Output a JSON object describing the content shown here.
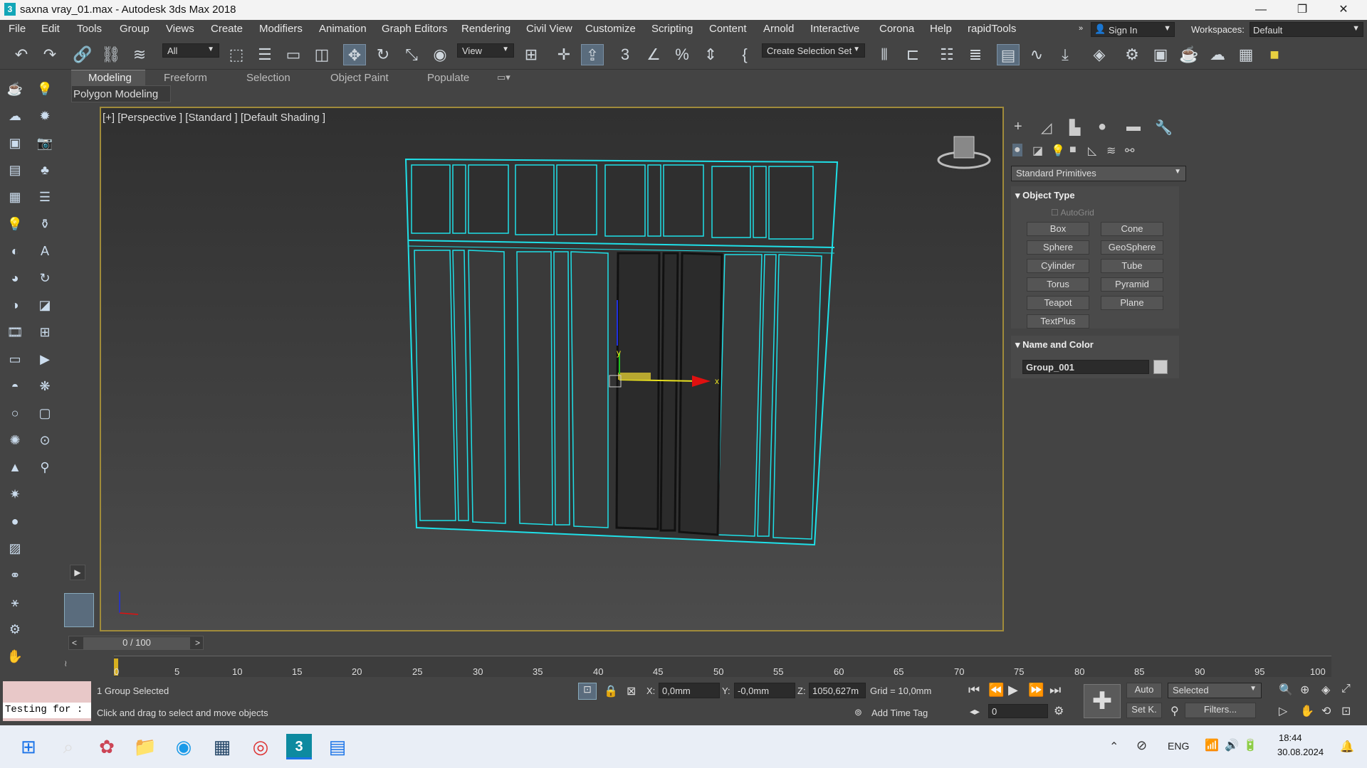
{
  "window": {
    "title": "saxna vray_01.max - Autodesk 3ds Max 2018",
    "app_icon": "3"
  },
  "menu": [
    "File",
    "Edit",
    "Tools",
    "Group",
    "Views",
    "Create",
    "Modifiers",
    "Animation",
    "Graph Editors",
    "Rendering",
    "Civil View",
    "Customize",
    "Scripting",
    "Content",
    "Arnold",
    "Interactive",
    "Corona",
    "Help",
    "rapidTools"
  ],
  "signin": "Sign In",
  "workspaces_label": "Workspaces:",
  "workspaces_value": "Default",
  "toolbar": {
    "filter": "All",
    "refcoord": "View",
    "selset": "Create Selection Set"
  },
  "ribbon_tabs": [
    "Modeling",
    "Freeform",
    "Selection",
    "Object Paint",
    "Populate"
  ],
  "ribbon_sub": "Polygon Modeling",
  "viewport_label": "[+] [Perspective ] [Standard ] [Default Shading ]",
  "gizmo": {
    "x": "x",
    "y": "y"
  },
  "command": {
    "dropdown": "Standard Primitives",
    "rollout_object_type": "Object Type",
    "autogrid": "AutoGrid",
    "buttons": [
      "Box",
      "Cone",
      "Sphere",
      "GeoSphere",
      "Cylinder",
      "Tube",
      "Torus",
      "Pyramid",
      "Teapot",
      "Plane",
      "TextPlus"
    ],
    "rollout_name_color": "Name and Color",
    "name": "Group_001"
  },
  "timeline": {
    "frame": "0 / 100",
    "prev": "<",
    "next": ">",
    "ticks": [
      "0",
      "5",
      "10",
      "15",
      "20",
      "25",
      "30",
      "35",
      "40",
      "45",
      "50",
      "55",
      "60",
      "65",
      "70",
      "75",
      "80",
      "85",
      "90",
      "95",
      "100"
    ]
  },
  "status": {
    "maxscript": "Testing for :",
    "selected": "1 Group Selected",
    "prompt": "Click and drag to select and move objects",
    "x_label": "X:",
    "x": "0,0mm",
    "y_label": "Y:",
    "y": "-0,0mm",
    "z_label": "Z:",
    "z": "1050,627m",
    "grid": "Grid = 10,0mm",
    "addtimetag": "Add Time Tag",
    "auto": "Auto",
    "setk": "Set K.",
    "selected_dd": "Selected",
    "filters": "Filters...",
    "frame_field": "0"
  },
  "taskbar": {
    "lang": "ENG",
    "time": "18:44",
    "date": "30.08.2024"
  },
  "colors": {
    "selection": "#1fe0e8",
    "viewport_border": "#a08b3a",
    "red": "#e01010",
    "yellow": "#e8e020"
  }
}
